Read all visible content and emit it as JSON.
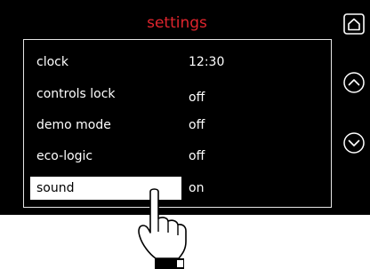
{
  "screen": {
    "title": "settings",
    "accent_color": "#e0252d"
  },
  "menu": {
    "items": [
      {
        "label": "clock",
        "value": "12:30",
        "selected": false
      },
      {
        "label": "controls lock",
        "value": "off",
        "selected": false
      },
      {
        "label": "demo mode",
        "value": "off",
        "selected": false
      },
      {
        "label": "eco-logic",
        "value": "off",
        "selected": false
      },
      {
        "label": "sound",
        "value": "on",
        "selected": true
      }
    ]
  },
  "icons": {
    "home": "home-icon",
    "up": "chevron-up-icon",
    "down": "chevron-down-icon",
    "hand": "pointing-hand-icon"
  }
}
